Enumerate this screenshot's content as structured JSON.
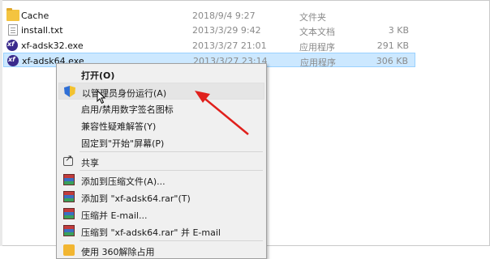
{
  "files": [
    {
      "name": "Cache",
      "date": "2018/9/4 9:27",
      "type": "文件夹",
      "size": "",
      "icon": "folder-icon"
    },
    {
      "name": "install.txt",
      "date": "2013/3/29 9:42",
      "type": "文本文档",
      "size": "3 KB",
      "icon": "text-file-icon"
    },
    {
      "name": "xf-adsk32.exe",
      "date": "2013/3/27 21:01",
      "type": "应用程序",
      "size": "291 KB",
      "icon": "xf-exe-icon"
    },
    {
      "name": "xf-adsk64.exe",
      "date": "2013/3/27 23:14",
      "type": "应用程序",
      "size": "306 KB",
      "icon": "xf-exe-icon"
    }
  ],
  "context_menu": {
    "items": [
      {
        "label": "打开(O)",
        "icon": ""
      },
      {
        "label": "以管理员身份运行(A)",
        "icon": "uac-shield-icon"
      },
      {
        "label": "启用/禁用数字签名图标",
        "icon": ""
      },
      {
        "label": "兼容性疑难解答(Y)",
        "icon": ""
      },
      {
        "label": "固定到\"开始\"屏幕(P)",
        "icon": ""
      },
      {
        "label": "共享",
        "icon": "share-icon"
      },
      {
        "label": "添加到压缩文件(A)...",
        "icon": "winrar-icon"
      },
      {
        "label": "添加到 \"xf-adsk64.rar\"(T)",
        "icon": "winrar-icon"
      },
      {
        "label": "压缩并 E-mail...",
        "icon": "winrar-icon"
      },
      {
        "label": "压缩到 \"xf-adsk64.rar\" 并 E-mail",
        "icon": "winrar-icon"
      },
      {
        "label": "使用 360解除占用",
        "icon": "360-icon"
      }
    ]
  },
  "colors": {
    "selection": "#cce8ff",
    "menu_background": "#f0f0f0",
    "annotation_arrow": "#e0201c"
  }
}
